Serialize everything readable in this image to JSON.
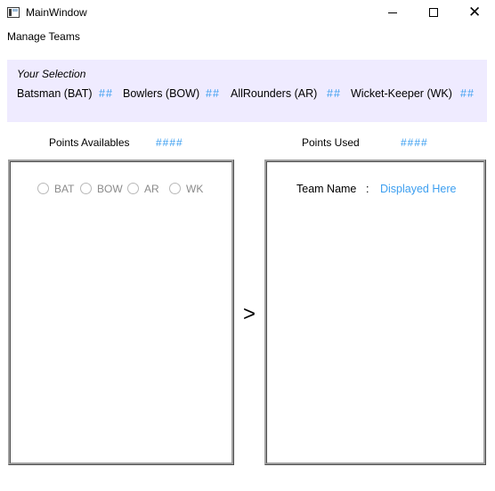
{
  "window": {
    "title": "MainWindow",
    "controls": {
      "minimize": "─",
      "maximize": "☐",
      "close": "✕"
    }
  },
  "menu": {
    "items": [
      "Manage Teams"
    ]
  },
  "selection": {
    "title": "Your Selection",
    "items": [
      {
        "label": "Batsman (BAT)",
        "value": "##"
      },
      {
        "label": "Bowlers (BOW)",
        "value": "##"
      },
      {
        "label": "AllRounders (AR)",
        "value": "##"
      },
      {
        "label": "Wicket-Keeper (WK)",
        "value": "##"
      }
    ]
  },
  "points": {
    "available_label": "Points Availables",
    "available_value": "####",
    "used_label": "Points Used",
    "used_value": "####"
  },
  "player_filter": {
    "options": [
      "BAT",
      "BOW",
      "AR",
      "WK"
    ]
  },
  "team": {
    "name_label": "Team Name",
    "separator": ":",
    "name_value": "Displayed Here"
  },
  "move_button": {
    "label": ">"
  },
  "colors": {
    "accent": "#3d9ff0",
    "selection_bg": "#efebff",
    "frame": "#a0a0a0"
  }
}
